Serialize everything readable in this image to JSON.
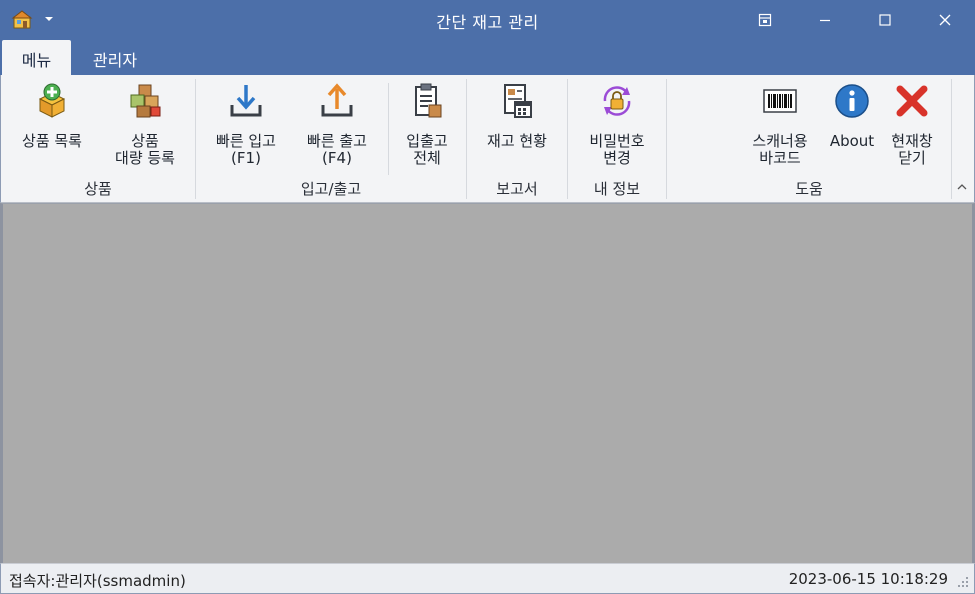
{
  "window": {
    "title": "간단 재고 관리",
    "controls": [
      "restore-layout",
      "minimize",
      "maximize",
      "close"
    ]
  },
  "tabs": [
    {
      "label": "메뉴",
      "active": true
    },
    {
      "label": "관리자",
      "active": false
    }
  ],
  "ribbon": {
    "groups": [
      {
        "label": "상품",
        "buttons": [
          {
            "label": "상품 목록",
            "icon": "box-add-icon"
          },
          {
            "label": "상품\n대량 등록",
            "icon": "boxes-bulk-icon"
          }
        ]
      },
      {
        "label": "입고/출고",
        "buttons": [
          {
            "label": "빠른 입고\n(F1)",
            "icon": "inbound-arrow-icon"
          },
          {
            "label": "빠른 출고\n(F4)",
            "icon": "outbound-arrow-icon"
          },
          {
            "label": "입출고\n전체",
            "icon": "clipboard-list-icon"
          }
        ]
      },
      {
        "label": "보고서",
        "buttons": [
          {
            "label": "재고 현황",
            "icon": "report-calendar-icon"
          }
        ]
      },
      {
        "label": "내 정보",
        "buttons": [
          {
            "label": "비밀번호\n변경",
            "icon": "lock-refresh-icon"
          }
        ]
      },
      {
        "label": "도움",
        "buttons": [
          {
            "label": "스캐너용\n바코드",
            "icon": "barcode-icon"
          },
          {
            "label": "About",
            "icon": "info-icon"
          },
          {
            "label": "현재창\n닫기",
            "icon": "close-x-icon"
          }
        ]
      }
    ]
  },
  "status": {
    "user": "접속자:관리자(ssmadmin)",
    "datetime": "2023-06-15 10:18:29"
  },
  "colors": {
    "titlebar": "#4c6fa9",
    "ribbon_bg": "#f3f4f6",
    "workspace": "#ababab",
    "accent_orange": "#e8892b",
    "accent_blue": "#2e78c8",
    "accent_red": "#d8332a",
    "accent_purple": "#9b4bd6"
  }
}
